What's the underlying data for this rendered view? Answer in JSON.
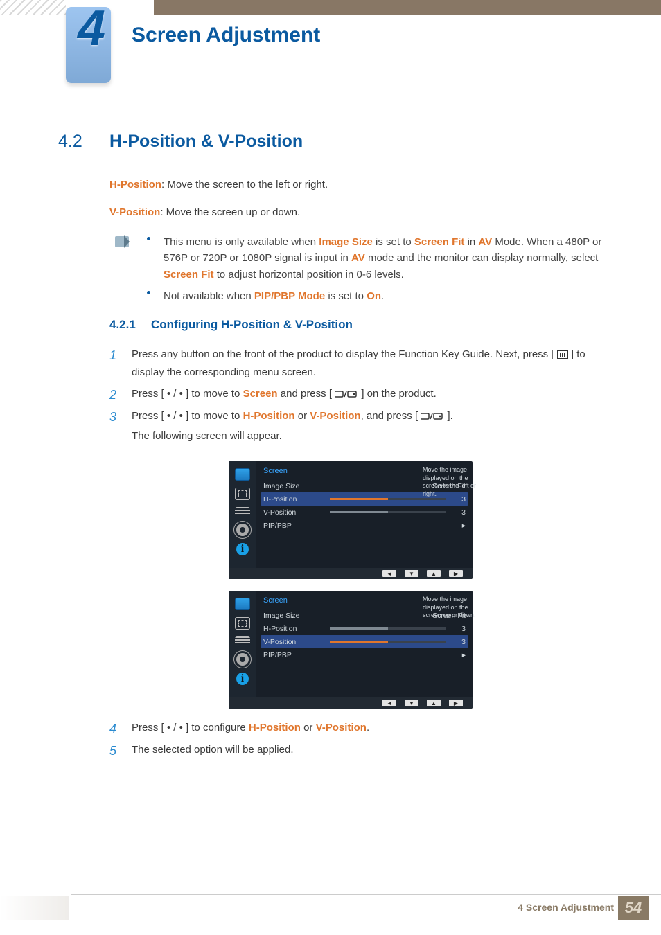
{
  "chapter": {
    "number": "4",
    "title": "Screen Adjustment"
  },
  "section": {
    "number": "4.2",
    "title": "H-Position & V-Position"
  },
  "intro": {
    "hpos_key": "H-Position",
    "hpos_text": ": Move the screen to the left or right.",
    "vpos_key": "V-Position",
    "vpos_text": ": Move the screen up or down."
  },
  "notes": {
    "n1_pre": "This menu is only available when ",
    "n1_a": "Image Size",
    "n1_mid1": " is set to ",
    "n1_b": "Screen Fit",
    "n1_mid2": " in ",
    "n1_c": "AV",
    "n1_mid3": " Mode. When a 480P or 576P or 720P or 1080P signal is input in ",
    "n1_d": "AV",
    "n1_mid4": " mode and the monitor can display normally, select ",
    "n1_e": "Screen Fit",
    "n1_post": " to adjust horizontal position in 0-6 levels.",
    "n2_pre": "Not available when ",
    "n2_a": "PIP/PBP Mode",
    "n2_mid": " is set to ",
    "n2_b": "On",
    "n2_post": "."
  },
  "subsection": {
    "number": "4.2.1",
    "title": "Configuring H-Position & V-Position"
  },
  "steps": {
    "s1": {
      "num": "1",
      "t1": "Press any button on the front of the product to display the Function Key Guide. Next, press [",
      "t2": "] to display the corresponding menu screen."
    },
    "s2": {
      "num": "2",
      "t1": "Press [ • / • ] to move to ",
      "a": "Screen",
      "t2": " and press [",
      "t3": "] on the product."
    },
    "s3": {
      "num": "3",
      "t1": "Press [ • / • ] to move to ",
      "a": "H-Position",
      "t2": " or ",
      "b": "V-Position",
      "t3": ", and press [",
      "t4": "].",
      "t5": "The following screen will appear."
    },
    "s4": {
      "num": "4",
      "t1": "Press [ • / • ] to configure ",
      "a": "H-Position",
      "t2": " or ",
      "b": "V-Position",
      "t3": "."
    },
    "s5": {
      "num": "5",
      "t1": "The selected option will be applied."
    }
  },
  "osd": {
    "title": "Screen",
    "rows": {
      "image_size": {
        "label": "Image Size",
        "value": "Screen Fit"
      },
      "h_position": {
        "label": "H-Position",
        "value": "3"
      },
      "v_position": {
        "label": "V-Position",
        "value": "3"
      },
      "pip_pbp": {
        "label": "PIP/PBP",
        "value": "▸"
      }
    },
    "hint1": "Move the image displayed on the screen to the left or right.",
    "hint2": "Move the image displayed on the screen up or down.",
    "info_glyph": "i",
    "foot": [
      "◄",
      "▼",
      "▲",
      "▶"
    ]
  },
  "footer": {
    "label": "4 Screen Adjustment",
    "page": "54"
  }
}
